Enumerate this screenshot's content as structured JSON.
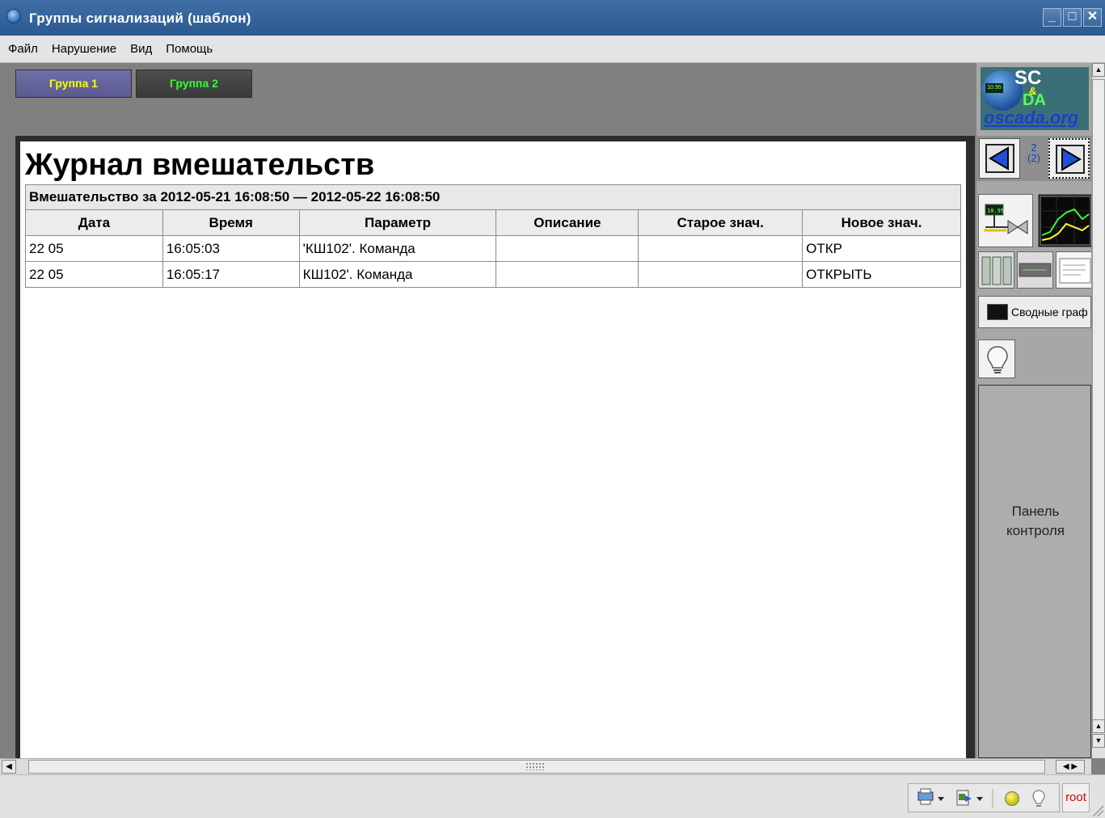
{
  "window": {
    "title": "Группы сигнализаций (шаблон)",
    "controls": [
      "_",
      "□",
      "✕"
    ]
  },
  "menu": {
    "items": [
      "Файл",
      "Нарушение",
      "Вид",
      "Помощь"
    ]
  },
  "groups": [
    {
      "label": "Группа 1",
      "color": "#ffff00"
    },
    {
      "label": "Группа 2",
      "color": "#33ff33"
    }
  ],
  "journal": {
    "title": "Журнал вмешательств",
    "period": "Вмешательство за 2012-05-21 16:08:50 — 2012-05-22 16:08:50",
    "columns": [
      "Дата",
      "Время",
      "Параметр",
      "Описание",
      "Старое знач.",
      "Новое знач."
    ],
    "rows": [
      [
        "22 05",
        "16:05:03",
        "'КШ102'. Команда",
        "",
        "",
        "ОТКР"
      ],
      [
        "22 05",
        "16:05:17",
        "КШ102'. Команда",
        "",
        "",
        "ОТКРЫТЬ"
      ]
    ]
  },
  "logo": {
    "sc": "SC",
    "amp": "&",
    "da": "DA",
    "site": "oscada.org",
    "lcd": "10.95"
  },
  "navigation": {
    "page": "2",
    "total": "(2)"
  },
  "summary_button": {
    "label": "Сводные граф"
  },
  "control_panel": {
    "label_line1": "Панель",
    "label_line2": "контроля"
  },
  "statusbar": {
    "user": "root"
  },
  "colors": {
    "titlebar": "#2b5a92",
    "user_text": "#e00000",
    "logo_link": "#1a3fcc"
  }
}
